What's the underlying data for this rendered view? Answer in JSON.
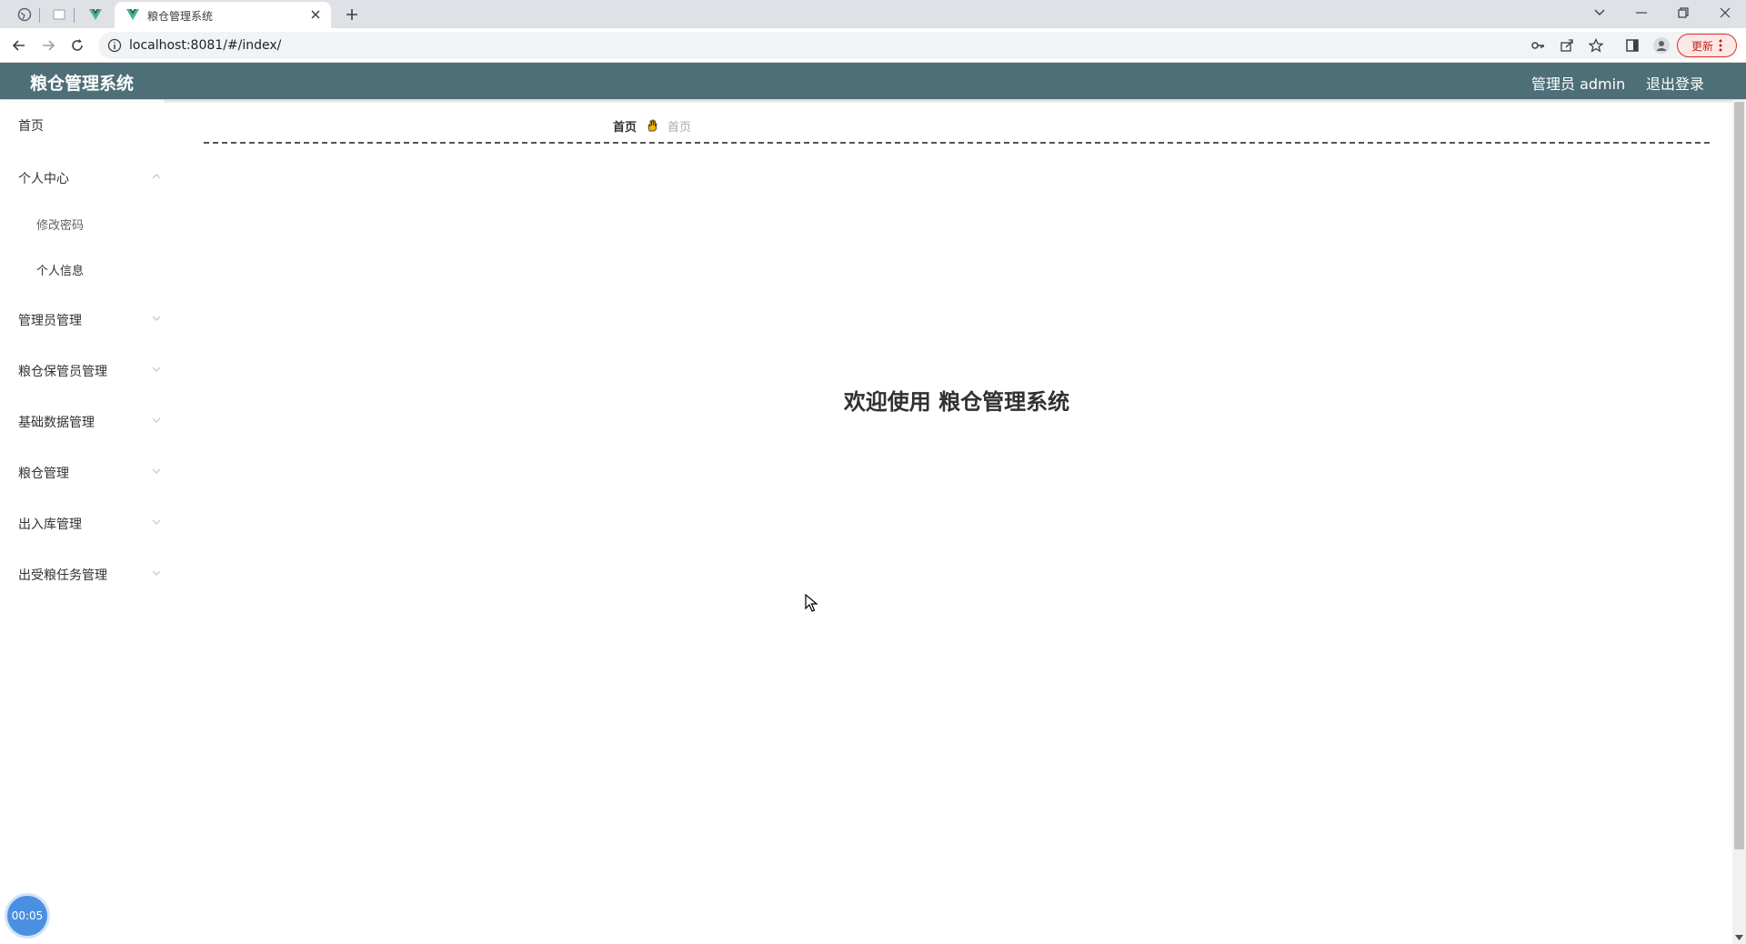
{
  "browser": {
    "active_tab_title": "粮仓管理系统",
    "url": "localhost:8081/#/index/",
    "update_label": "更新"
  },
  "header": {
    "title": "粮仓管理系统",
    "user": "管理员 admin",
    "logout": "退出登录"
  },
  "sidebar": {
    "items": [
      {
        "label": "首页"
      },
      {
        "label": "个人中心"
      },
      {
        "label": "修改密码"
      },
      {
        "label": "个人信息"
      },
      {
        "label": "管理员管理"
      },
      {
        "label": "粮仓保管员管理"
      },
      {
        "label": "基础数据管理"
      },
      {
        "label": "粮仓管理"
      },
      {
        "label": "出入库管理"
      },
      {
        "label": "出受粮任务管理"
      }
    ]
  },
  "breadcrumb": {
    "home": "首页",
    "current": "首页"
  },
  "main": {
    "welcome": "欢迎使用 粮仓管理系统"
  },
  "timer": {
    "value": "00:05"
  }
}
